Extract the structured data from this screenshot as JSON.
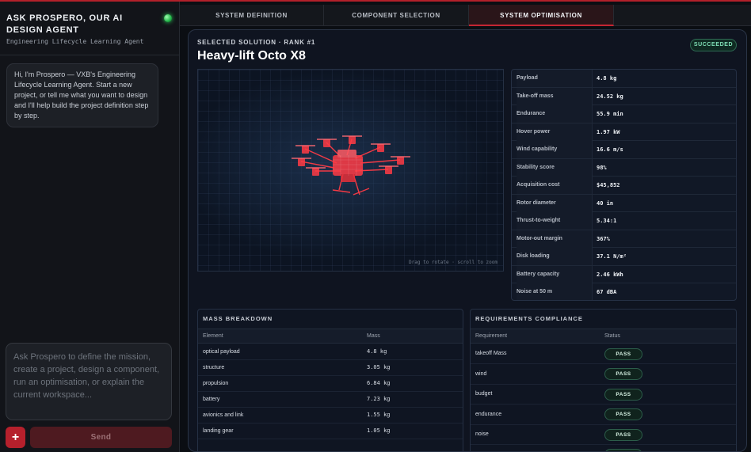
{
  "sidebar": {
    "title": "ASK PROSPERO, OUR AI DESIGN AGENT",
    "subtitle": "Engineering Lifecycle Learning Agent",
    "message": "Hi, I'm Prospero — VXB's Engineering Lifecycle Learning Agent. Start a new project, or tell me what you want to design and I'll help build the project definition step by step.",
    "input_placeholder": "Ask Prospero to define the mission, create a project, design a component, run an optimisation, or explain the current workspace...",
    "plus_label": "+",
    "send_label": "Send"
  },
  "tabs": [
    {
      "label": "SYSTEM DEFINITION",
      "active": false
    },
    {
      "label": "COMPONENT SELECTION",
      "active": false
    },
    {
      "label": "SYSTEM OPTIMISATION",
      "active": true
    }
  ],
  "solution": {
    "label": "SELECTED SOLUTION · RANK #1",
    "title": "Heavy-lift Octo X8",
    "status": "SUCCEEDED",
    "viewer_hint": "Drag to rotate · scroll to zoom"
  },
  "specs": [
    {
      "key": "Payload",
      "value": "4.8 kg"
    },
    {
      "key": "Take-off mass",
      "value": "24.52 kg"
    },
    {
      "key": "Endurance",
      "value": "55.9 min"
    },
    {
      "key": "Hover power",
      "value": "1.97 kW"
    },
    {
      "key": "Wind capability",
      "value": "16.6 m/s"
    },
    {
      "key": "Stability score",
      "value": "98%"
    },
    {
      "key": "Acquisition cost",
      "value": "$45,852"
    },
    {
      "key": "Rotor diameter",
      "value": "40 in"
    },
    {
      "key": "Thrust-to-weight",
      "value": "5.34:1"
    },
    {
      "key": "Motor-out margin",
      "value": "367%"
    },
    {
      "key": "Disk loading",
      "value": "37.1 N/m²"
    },
    {
      "key": "Battery capacity",
      "value": "2.46 kWh"
    },
    {
      "key": "Noise at 50 m",
      "value": "67 dBA"
    }
  ],
  "mass": {
    "title": "MASS BREAKDOWN",
    "col_element": "Element",
    "col_mass": "Mass",
    "rows": [
      {
        "element": "optical payload",
        "mass": "4.8 kg"
      },
      {
        "element": "structure",
        "mass": "3.05 kg"
      },
      {
        "element": "propulsion",
        "mass": "6.84 kg"
      },
      {
        "element": "battery",
        "mass": "7.23 kg"
      },
      {
        "element": "avionics and link",
        "mass": "1.55 kg"
      },
      {
        "element": "landing gear",
        "mass": "1.05 kg"
      }
    ]
  },
  "compliance": {
    "title": "REQUIREMENTS COMPLIANCE",
    "col_requirement": "Requirement",
    "col_status": "Status",
    "rows": [
      {
        "requirement": "takeoff Mass",
        "status": "PASS"
      },
      {
        "requirement": "wind",
        "status": "PASS"
      },
      {
        "requirement": "budget",
        "status": "PASS"
      },
      {
        "requirement": "endurance",
        "status": "PASS"
      },
      {
        "requirement": "noise",
        "status": "PASS"
      }
    ]
  },
  "colors": {
    "accent": "#c52633",
    "drone": "#ff3b45",
    "pass": "#7fe0b6"
  }
}
